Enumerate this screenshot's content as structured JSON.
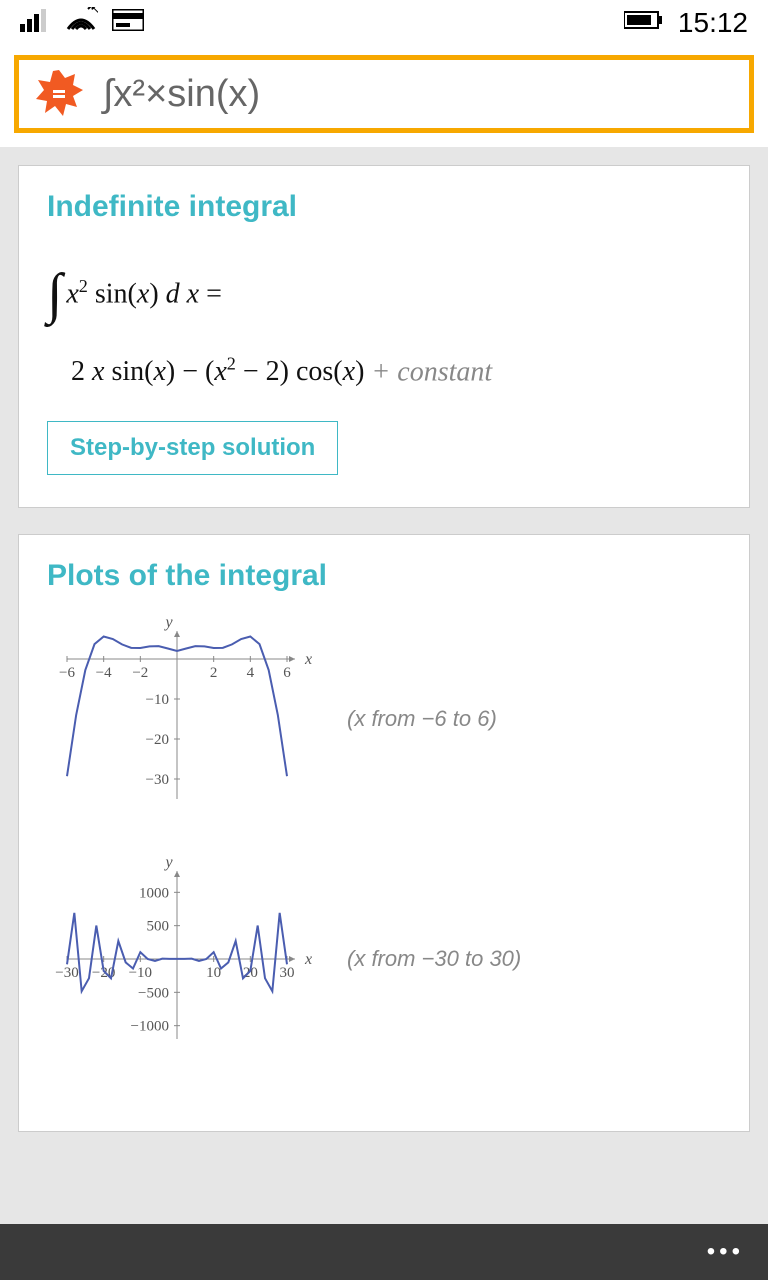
{
  "status": {
    "time": "15:12"
  },
  "search": {
    "query": "∫x²×sin(x)"
  },
  "integral_card": {
    "title": "Indefinite integral",
    "expr_line1": "x² sin(x) d x =",
    "expr_line2_main": "2 x sin(x) − (x² − 2) cos(x)",
    "expr_line2_constant": "+ constant",
    "button": "Step-by-step solution"
  },
  "plots_card": {
    "title": "Plots of the integral",
    "plot1_label": "(x from −6 to 6)",
    "plot2_label": "(x from −30 to 30)"
  },
  "chart_data": [
    {
      "type": "line",
      "title": "",
      "xlabel": "x",
      "ylabel": "y",
      "xlim": [
        -6,
        6
      ],
      "ylim": [
        -35,
        5
      ],
      "x_ticks": [
        -6,
        -4,
        -2,
        2,
        4,
        6
      ],
      "y_ticks": [
        -10,
        -20,
        -30
      ],
      "series": [
        {
          "name": "integral",
          "expr": "2*x*sin(x)-(x^2-2)*cos(x)",
          "x": [
            -6,
            -5.5,
            -5,
            -4.5,
            -4,
            -3.5,
            -3,
            -2.5,
            -2,
            -1.5,
            -1,
            -0.5,
            0,
            0.5,
            1,
            1.5,
            2,
            2.5,
            3,
            3.5,
            4,
            4.5,
            5,
            5.5,
            6
          ],
          "y": [
            -29.3,
            -14.0,
            -2.75,
            3.72,
            5.63,
            4.99,
            3.65,
            2.79,
            2.75,
            3.16,
            3.22,
            2.62,
            2.0,
            2.62,
            3.22,
            3.16,
            2.75,
            2.79,
            3.65,
            4.99,
            5.63,
            3.72,
            -2.75,
            -14.0,
            -29.3
          ]
        }
      ]
    },
    {
      "type": "line",
      "title": "",
      "xlabel": "x",
      "ylabel": "y",
      "xlim": [
        -30,
        30
      ],
      "ylim": [
        -1200,
        1200
      ],
      "x_ticks": [
        -30,
        -20,
        -10,
        10,
        20,
        30
      ],
      "y_ticks": [
        -1000,
        -500,
        500,
        1000
      ],
      "series": [
        {
          "name": "integral",
          "expr": "2*x*sin(x)-(x^2-2)*cos(x)",
          "x": [
            -30,
            -28,
            -26,
            -24,
            -22,
            -20,
            -18,
            -16,
            -14,
            -12,
            -10,
            -8,
            -6,
            -4,
            -2,
            0,
            2,
            4,
            6,
            8,
            10,
            12,
            14,
            16,
            18,
            20,
            22,
            24,
            26,
            28,
            30
          ],
          "y": [
            -79.9,
            692,
            -484,
            -288,
            502,
            -178,
            -290,
            270,
            -50.8,
            -143,
            103,
            0.67,
            -29.3,
            5.63,
            2.75,
            2.0,
            2.75,
            5.63,
            -29.3,
            0.67,
            103,
            -143,
            -50.8,
            270,
            -290,
            -178,
            502,
            -288,
            -484,
            692,
            -79.9
          ]
        }
      ]
    }
  ]
}
